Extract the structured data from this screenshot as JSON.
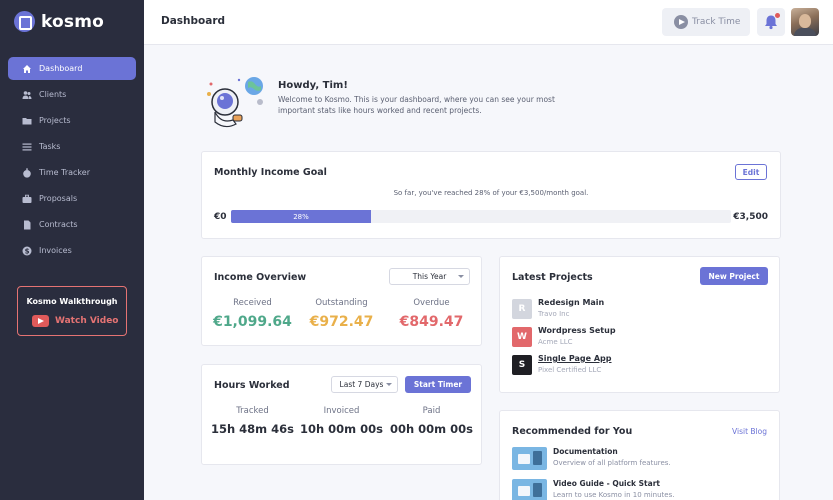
{
  "app": {
    "brand": "kosmo",
    "accent": "#6b73d6"
  },
  "sidebar": {
    "items": [
      {
        "label": "Dashboard",
        "icon": "home-icon",
        "active": true
      },
      {
        "label": "Clients",
        "icon": "users-icon"
      },
      {
        "label": "Projects",
        "icon": "folder-icon"
      },
      {
        "label": "Tasks",
        "icon": "list-icon"
      },
      {
        "label": "Time Tracker",
        "icon": "stopwatch-icon"
      },
      {
        "label": "Proposals",
        "icon": "briefcase-icon"
      },
      {
        "label": "Contracts",
        "icon": "document-icon"
      },
      {
        "label": "Invoices",
        "icon": "dollar-icon"
      }
    ],
    "walkthrough": {
      "title": "Kosmo Walkthrough",
      "link": "Watch Video"
    }
  },
  "header": {
    "title": "Dashboard",
    "track_time": "Track Time"
  },
  "greeting": {
    "title": "Howdy, Tim!",
    "text": "Welcome to Kosmo. This is your dashboard, where you can see your most important stats like hours worked and recent projects."
  },
  "income_goal": {
    "title": "Monthly Income Goal",
    "edit": "Edit",
    "subtitle": "So far, you've reached 28% of your €3,500/month goal.",
    "min_label": "€0",
    "max_label": "€3,500",
    "progress_label": "28%",
    "progress": 0.28
  },
  "income_overview": {
    "title": "Income Overview",
    "period": "This Year",
    "stats": [
      {
        "label": "Received",
        "value": "€1,099.64",
        "color": "#4fa88a"
      },
      {
        "label": "Outstanding",
        "value": "€972.47",
        "color": "#e9b04a"
      },
      {
        "label": "Overdue",
        "value": "€849.47",
        "color": "#e2686b"
      }
    ]
  },
  "hours_worked": {
    "title": "Hours Worked",
    "period": "Last 7 Days",
    "button": "Start Timer",
    "stats": [
      {
        "label": "Tracked",
        "value": "15h 48m 46s"
      },
      {
        "label": "Invoiced",
        "value": "10h 00m 00s"
      },
      {
        "label": "Paid",
        "value": "00h 00m 00s"
      }
    ]
  },
  "latest_projects": {
    "title": "Latest Projects",
    "button": "New Project",
    "items": [
      {
        "badge": "R",
        "name": "Redesign Main",
        "client": "Travo Inc",
        "color": "#d3d6de"
      },
      {
        "badge": "W",
        "name": "Wordpress Setup",
        "client": "Acme LLC",
        "color": "#e2686b"
      },
      {
        "badge": "S",
        "name": "Single Page App",
        "client": "Pixel Certified LLC",
        "color": "#1f1f24"
      }
    ]
  },
  "recommended": {
    "title": "Recommended for You",
    "link": "Visit Blog",
    "items": [
      {
        "title": "Documentation",
        "desc": "Overview of all platform features."
      },
      {
        "title": "Video Guide - Quick Start",
        "desc": "Learn to use Kosmo in 10 minutes."
      }
    ]
  }
}
